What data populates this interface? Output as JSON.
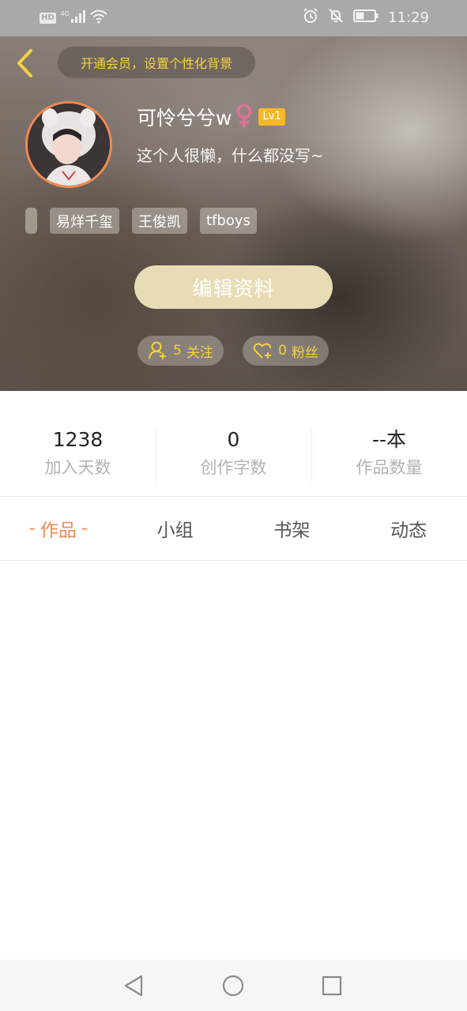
{
  "status_bar": {
    "hd": "HD",
    "network": "4G",
    "time": "11:29",
    "icons": [
      "signal-icon",
      "wifi-icon",
      "alarm-icon",
      "mute-icon",
      "battery-icon"
    ]
  },
  "header": {
    "vip_prompt": "开通会员，设置个性化背景",
    "username": "可怜兮兮w",
    "gender": "female",
    "level": "Lv1",
    "bio": "这个人很懒，什么都没写~",
    "tags": [
      "易烊千玺",
      "王俊凯",
      "tfboys"
    ],
    "edit_button": "编辑资料",
    "follow_count": "5",
    "follow_label": "关注",
    "fans_count": "0",
    "fans_label": "粉丝"
  },
  "stats": [
    {
      "value": "1238",
      "label": "加入天数"
    },
    {
      "value": "0",
      "label": "创作字数"
    },
    {
      "value": "--本",
      "label": "作品数量"
    }
  ],
  "tabs": {
    "active_dash": "-",
    "items": [
      "作品",
      "小组",
      "书架",
      "动态"
    ]
  },
  "colors": {
    "accent": "#f08a52",
    "gold": "#f3d33c",
    "edit_button": "#e7dcb5",
    "level_badge": "#f5b928",
    "gender": "#e0719a"
  }
}
